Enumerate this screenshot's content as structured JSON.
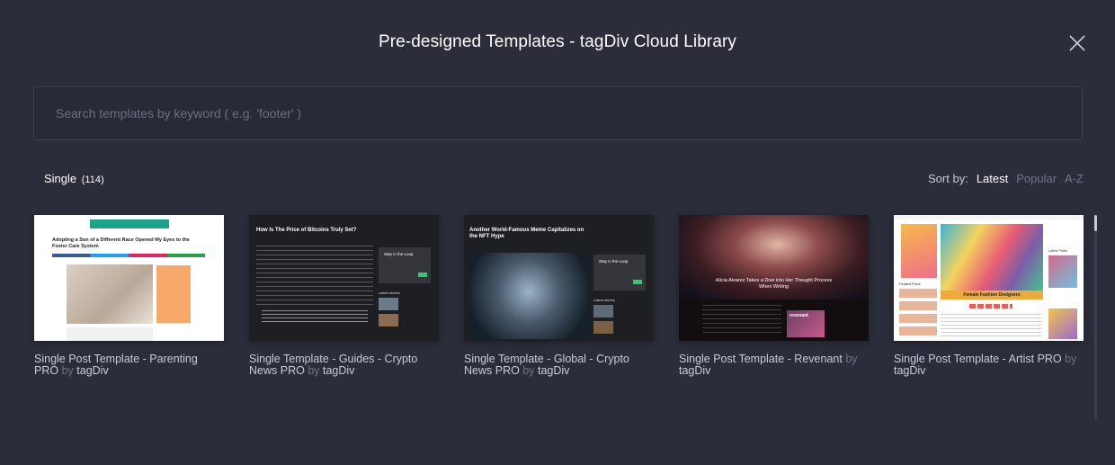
{
  "modal": {
    "title": "Pre-designed Templates - tagDiv Cloud Library",
    "close_icon": "close-icon"
  },
  "search": {
    "placeholder": "Search templates by keyword ( e.g. 'footer' )",
    "value": ""
  },
  "category": {
    "name": "Single",
    "count": "(114)"
  },
  "sort": {
    "label": "Sort by:",
    "options": [
      "Latest",
      "Popular",
      "A-Z"
    ],
    "active": "Latest"
  },
  "templates": [
    {
      "name": "Single Post Template - Parenting PRO",
      "by": "by",
      "author": "tagDiv",
      "thumb": {
        "headline": "Adopting a Son of a Different Race Opened My Eyes to the Foster Care System",
        "theme": "light",
        "accent": "#1aa58a"
      }
    },
    {
      "name": "Single Template - Guides - Crypto News PRO",
      "by": "by",
      "author": "tagDiv",
      "thumb": {
        "headline": "How Is The Price of Bitcoins Truly Set?",
        "side_title": "Stay in the Loop",
        "side_label": "Latest stories",
        "theme": "dark",
        "accent": "#2ecc71"
      }
    },
    {
      "name": "Single Template - Global - Crypto News PRO",
      "by": "by",
      "author": "tagDiv",
      "thumb": {
        "headline": "Another World-Famous Meme Capitalizes on the NFT Hype",
        "side_title": "Stay in the Loop",
        "side_label": "Latest stories",
        "theme": "dark",
        "accent": "#2ecc71"
      }
    },
    {
      "name": "Single Post Template - Revenant",
      "by": "by",
      "author": "tagDiv",
      "thumb": {
        "headline": "Alicia Alvarez Takes a Dive into Her Thought Process When Writing",
        "badge": "revenant",
        "theme": "dark",
        "accent": "#c0392b"
      }
    },
    {
      "name": "Single Post Template - Artist PRO",
      "by": "by",
      "author": "tagDiv",
      "thumb": {
        "headline": "Female Fashion Designers",
        "side_title": "Latest Posts",
        "side_label": "Related Posts",
        "theme": "light",
        "accent": "#f0a93b"
      }
    }
  ],
  "colors": {
    "background": "#2b2d3a",
    "search_bg": "#282a36",
    "text_primary": "#ffffff",
    "text_muted": "#70748a"
  }
}
